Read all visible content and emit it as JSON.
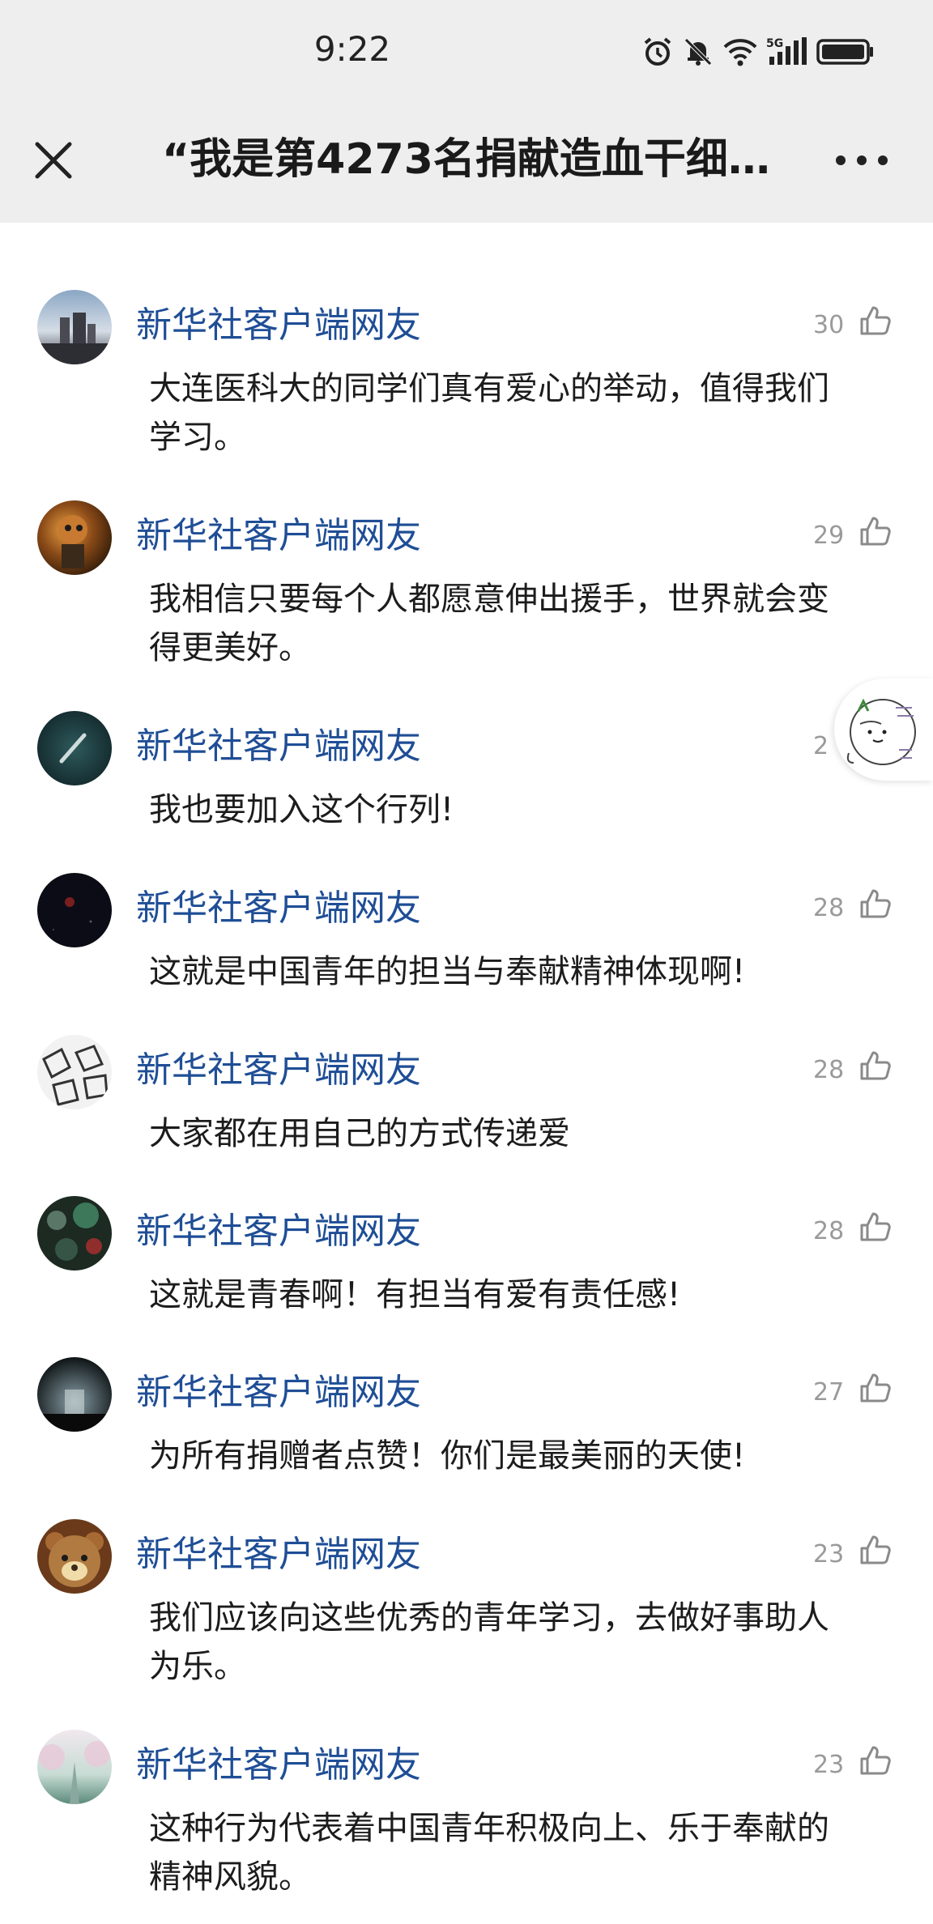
{
  "status_bar": {
    "time": "9:22",
    "icons": [
      "alarm-icon",
      "mute-bell-icon",
      "wifi-icon",
      "5g-signal-icon",
      "battery-icon"
    ],
    "network_label": "5G"
  },
  "nav": {
    "title": "“我是第4273名捐献造血干细…",
    "close_icon": "close-icon",
    "more_icon": "more-icon"
  },
  "comments": [
    {
      "user": "新华社客户端网友",
      "likes": "30",
      "content": "大连医科大的同学们真有爱心的举动，值得我们学习。",
      "avatar": "cityscape"
    },
    {
      "user": "新华社客户端网友",
      "likes": "29",
      "content": "我相信只要每个人都愿意伸出援手，世界就会变得更美好。",
      "avatar": "figurine"
    },
    {
      "user": "新华社客户端网友",
      "likes": "2",
      "content": "我也要加入这个行列!",
      "avatar": "ocean"
    },
    {
      "user": "新华社客户端网友",
      "likes": "28",
      "content": "这就是中国青年的担当与奉献精神体现啊!",
      "avatar": "night-sky"
    },
    {
      "user": "新华社客户端网友",
      "likes": "28",
      "content": "大家都在用自己的方式传递爱",
      "avatar": "sketch"
    },
    {
      "user": "新华社客户端网友",
      "likes": "28",
      "content": "这就是青春啊！有担当有爱有责任感!",
      "avatar": "bokeh"
    },
    {
      "user": "新华社客户端网友",
      "likes": "27",
      "content": "为所有捐赠者点赞！你们是最美丽的天使!",
      "avatar": "concert"
    },
    {
      "user": "新华社客户端网友",
      "likes": "23",
      "content": "我们应该向这些优秀的青年学习，去做好事助人为乐。",
      "avatar": "bear"
    },
    {
      "user": "新华社客户端网友",
      "likes": "23",
      "content": "这种行为代表着中国青年积极向上、乐于奉献的精神风貌。",
      "avatar": "cherry-road"
    }
  ],
  "floating_widget": {
    "icon": "mascot-icon"
  },
  "colors": {
    "username": "#1f4e96",
    "header_bg": "#eeeeee",
    "like_count": "#9a9a9a"
  }
}
